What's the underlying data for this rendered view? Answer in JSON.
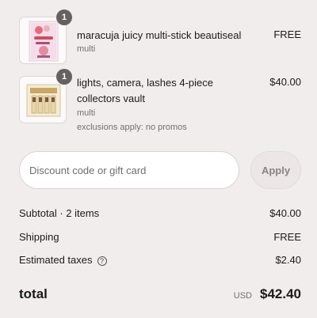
{
  "items": [
    {
      "quantity": "1",
      "name": "maracuja juicy multi-stick beautiseal",
      "variant": "multi",
      "price": "FREE",
      "image_icon": "lip-stick-product-icon"
    },
    {
      "quantity": "1",
      "name": "lights, camera, lashes 4-piece collectors vault",
      "variant": "multi",
      "note": "exclusions apply: no promos",
      "price": "$40.00",
      "image_icon": "mascara-vault-product-icon"
    }
  ],
  "discount": {
    "placeholder": "Discount code or gift card",
    "apply_label": "Apply"
  },
  "summary": {
    "subtotal_label": "Subtotal · 2 items",
    "subtotal_value": "$40.00",
    "shipping_label": "Shipping",
    "shipping_value": "FREE",
    "taxes_label": "Estimated taxes",
    "taxes_help_glyph": "?",
    "taxes_value": "$2.40"
  },
  "total": {
    "label": "total",
    "currency": "USD",
    "amount": "$42.40"
  },
  "colors": {
    "background": "#f2eded",
    "badge": "#666161",
    "apply_button_bg": "#ece6e6"
  }
}
